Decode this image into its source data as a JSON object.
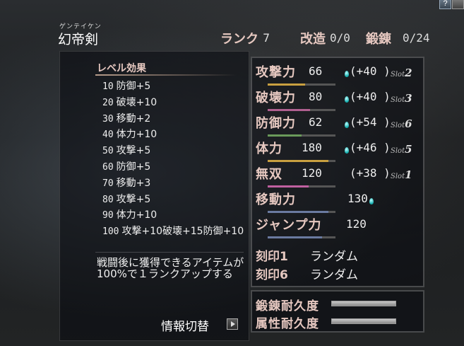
{
  "header": {
    "ruby": "ゲンテイケン",
    "weapon_name": "幻帝剣",
    "rank_label": "ランク",
    "rank_value": "7",
    "kaizo_label": "改造",
    "kaizo_value": "0/0",
    "tanren_label": "鍛錬",
    "tanren_value": "0/24"
  },
  "level_effects": {
    "title": "レベル効果",
    "rows": [
      {
        "level": "10",
        "effect": "防御+5"
      },
      {
        "level": "20",
        "effect": "破壊+10"
      },
      {
        "level": "30",
        "effect": "移動+2"
      },
      {
        "level": "40",
        "effect": "体力+10"
      },
      {
        "level": "50",
        "effect": "攻撃+5"
      },
      {
        "level": "60",
        "effect": "防御+5"
      },
      {
        "level": "70",
        "effect": "移動+3"
      },
      {
        "level": "80",
        "effect": "攻撃+5"
      },
      {
        "level": "90",
        "effect": "体力+10"
      },
      {
        "level": "100",
        "effect": "攻撃+10破壊+15防御+10"
      }
    ],
    "description": "戦闘後に獲得できるアイテムが100%で１ランクアップする",
    "info_toggle": "情報切替"
  },
  "stats": [
    {
      "label": "攻撃力",
      "value": "66",
      "bonus": "(+40 )",
      "slot": "2",
      "bar_color": "#c9a040",
      "bar_fill": 0.55
    },
    {
      "label": "破壊力",
      "value": "80",
      "bonus": "(+40 )",
      "slot": "3",
      "bar_color": "#b06090",
      "bar_fill": 0.62
    },
    {
      "label": "防御力",
      "value": "62",
      "bonus": "(+54 )",
      "slot": "6",
      "bar_color": "#6a9a5a",
      "bar_fill": 0.5
    },
    {
      "label": "体力",
      "value": "180",
      "bonus": "(+46 )",
      "slot": "5",
      "bar_color": "#c9a040",
      "bar_fill": 0.9
    },
    {
      "label": "無双",
      "value": "120",
      "bonus": "(+38 )",
      "slot": "1",
      "bar_color": "#c060a0",
      "bar_fill": 0.6
    },
    {
      "label": "移動力",
      "value": "130",
      "bar_color": "#6a7aa0",
      "bar_fill": 0.9
    },
    {
      "label": "ジャンプ力",
      "value": "120",
      "bar_color": "#6a7aa0",
      "bar_fill": 0.8
    }
  ],
  "slot_prefix": "Slot",
  "engraves": [
    {
      "label": "刻印1",
      "value": "ランダム"
    },
    {
      "label": "刻印6",
      "value": "ランダム"
    }
  ],
  "durability": [
    {
      "label": "鍛錬耐久度",
      "fill": 1.0
    },
    {
      "label": "属性耐久度",
      "fill": 1.0
    }
  ]
}
